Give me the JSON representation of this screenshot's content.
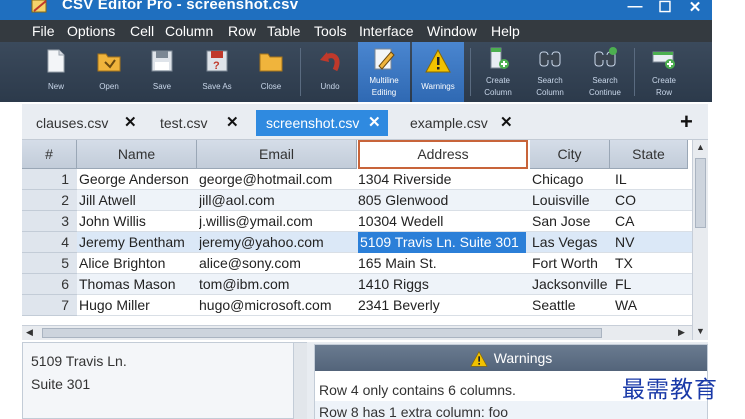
{
  "window": {
    "title": "CSV Editor Pro - screenshot.csv",
    "controls": [
      "—",
      "☐",
      "✕"
    ]
  },
  "menu": [
    "File",
    "Options",
    "Cell",
    "Column",
    "Row",
    "Table",
    "Tools",
    "Interface",
    "Window",
    "Help"
  ],
  "toolbar": {
    "new": "New",
    "open": "Open",
    "save": "Save",
    "save_as": "Save As",
    "close": "Close",
    "undo": "Undo",
    "multiline_1": "Multiline",
    "multiline_2": "Editing",
    "warnings": "Warnings",
    "create_column_1": "Create",
    "create_column_2": "Column",
    "search_column_1": "Search",
    "search_column_2": "Column",
    "search_continue_1": "Search",
    "search_continue_2": "Continue",
    "create_row_1": "Create",
    "create_row_2": "Row"
  },
  "tabs": [
    {
      "label": "clauses.csv",
      "close": "✕"
    },
    {
      "label": "test.csv",
      "close": "✕"
    },
    {
      "label": "screenshot.csv",
      "close": "✕"
    },
    {
      "label": "example.csv",
      "close": "✕"
    }
  ],
  "tab_add": "+",
  "grid": {
    "row_header": "#",
    "columns": [
      "Name",
      "Email",
      "Address",
      "City",
      "State"
    ],
    "rows": [
      {
        "n": "1",
        "name": "George Anderson",
        "email": "george@hotmail.com",
        "address": "1304 Riverside",
        "city": "Chicago",
        "state": "IL"
      },
      {
        "n": "2",
        "name": "Jill Atwell",
        "email": "jill@aol.com",
        "address": "805 Glenwood",
        "city": "Louisville",
        "state": "CO"
      },
      {
        "n": "3",
        "name": "John Willis",
        "email": "j.willis@ymail.com",
        "address": "10304 Wedell",
        "city": "San Jose",
        "state": "CA"
      },
      {
        "n": "4",
        "name": "Jeremy Bentham",
        "email": "jeremy@yahoo.com",
        "address": "5109 Travis Ln. Suite 301",
        "city": "Las Vegas",
        "state": "NV"
      },
      {
        "n": "5",
        "name": "Alice Brighton",
        "email": "alice@sony.com",
        "address": "165 Main St.",
        "city": "Fort Worth",
        "state": "TX"
      },
      {
        "n": "6",
        "name": "Thomas Mason",
        "email": "tom@ibm.com",
        "address": "1410 Riggs",
        "city": "Jacksonville",
        "state": "FL"
      },
      {
        "n": "7",
        "name": "Hugo Miller",
        "email": "hugo@microsoft.com",
        "address": "2341 Beverly",
        "city": "Seattle",
        "state": "WA"
      }
    ]
  },
  "cell_preview": [
    "5109 Travis Ln.",
    "Suite 301"
  ],
  "warnings": {
    "title": "Warnings",
    "lines": [
      "Row 4 only contains 6 columns.",
      "Row 8 has 1 extra column: foo"
    ]
  },
  "watermark": "最需教育",
  "colors": {
    "accent": "#2b7fd8",
    "titlebar": "#1f6fbf",
    "warning": "#f2c200"
  }
}
